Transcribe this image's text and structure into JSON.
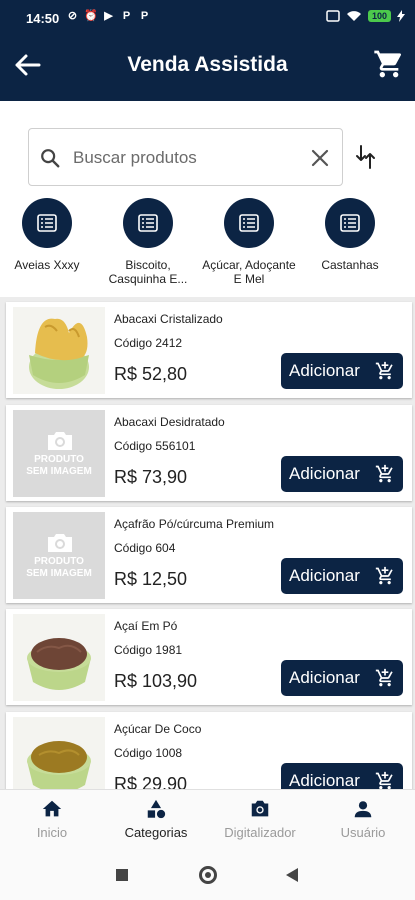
{
  "status_bar": {
    "time": "14:50",
    "notification_icons": [
      "sync-off-icon",
      "alarm-icon",
      "youtube-icon",
      "p-app-icon",
      "p-app-icon"
    ],
    "battery": "100"
  },
  "app_bar": {
    "title": "Venda Assistida",
    "back_icon": "arrow-left-icon",
    "cart_icon": "shopping-cart-icon"
  },
  "search": {
    "placeholder": "Buscar produtos",
    "value": ""
  },
  "categories": [
    {
      "label": "Aveias Xxxy"
    },
    {
      "label": "Biscoito, Casquinha E..."
    },
    {
      "label": "Açúcar, Adoçante E Mel"
    },
    {
      "label": "Castanhas"
    }
  ],
  "products": [
    {
      "name": "Abacaxi Cristalizado",
      "code": "Código 2412",
      "price": "R$ 52,80",
      "button": "Adicionar",
      "image": "candied-pineapple"
    },
    {
      "name": "Abacaxi Desidratado",
      "code": "Código 556101",
      "price": "R$ 73,90",
      "button": "Adicionar",
      "image": "none"
    },
    {
      "name": "Açafrão Pó/cúrcuma Premium",
      "code": "Código 604",
      "price": "R$ 12,50",
      "button": "Adicionar",
      "image": "none"
    },
    {
      "name": "Açaí Em Pó",
      "code": "Código 1981",
      "price": "R$ 103,90",
      "button": "Adicionar",
      "image": "acai-powder"
    },
    {
      "name": "Açúcar De Coco",
      "code": "Código 1008",
      "price": "R$ 29,90",
      "button": "Adicionar",
      "image": "coconut-sugar"
    }
  ],
  "no_image_text": [
    "PRODUTO",
    "SEM IMAGEM"
  ],
  "bottom_nav": [
    {
      "label": "Inicio",
      "icon": "home-icon",
      "active": false
    },
    {
      "label": "Categorias",
      "icon": "categories-icon",
      "active": true
    },
    {
      "label": "Digitalizador",
      "icon": "camera-icon",
      "active": false
    },
    {
      "label": "Usuário",
      "icon": "user-icon",
      "active": false
    }
  ],
  "colors": {
    "primary": "#0c2444",
    "background": "#ececec",
    "nav_inactive": "#9a9a9a"
  }
}
